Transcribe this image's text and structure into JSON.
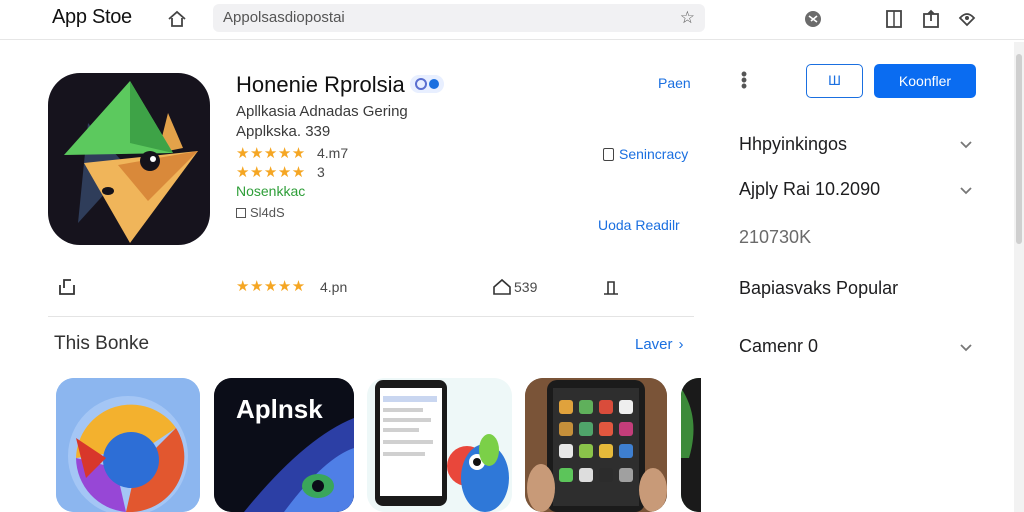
{
  "topbar": {
    "logo": "App Stoe",
    "search_value": "Appolsasdiopostai",
    "icons": [
      "home-icon",
      "star-icon",
      "globe-icon",
      "book-icon",
      "share-icon",
      "bell-icon"
    ]
  },
  "app": {
    "name": "Honenie Rprolsia",
    "developer_line": "Apllkasia Adnadas Gering",
    "category_line": "Applkska.  339",
    "rating1_stars": "★★★★★",
    "rating1_value": "4.m7",
    "rating2_stars": "★★★★★",
    "rating2_value": "3",
    "status": "Nosenkkac",
    "size_label": "Sl4dS",
    "icon_name": "app-fox-icon"
  },
  "links": {
    "open": "Paen",
    "summary": "Senincracy",
    "details": "Uoda Readilr"
  },
  "actions": {
    "outline_button": "Ш",
    "primary_button": "Koonfler"
  },
  "stats": {
    "stars": "★★★★★",
    "rating": "4.pn",
    "downloads": "539"
  },
  "panel": {
    "rows": [
      {
        "label": "Hhpyinkingos",
        "chevron": true
      },
      {
        "label": "Ajply  Rai  10.2090",
        "chevron": true
      },
      {
        "label": "210730K",
        "chevron": false
      },
      {
        "label": "Bapiasvaks Popular",
        "chevron": false
      },
      {
        "label": "Camenr 0",
        "chevron": true
      }
    ]
  },
  "section": {
    "title": "This Bonke",
    "more_link": "Laver",
    "cards": [
      {
        "label": "",
        "icon": "swirl-app-icon"
      },
      {
        "label": "Aplnsk",
        "icon": "space-app-icon"
      },
      {
        "label": "",
        "icon": "phone-screenshot"
      },
      {
        "label": "",
        "icon": "tablet-screenshot"
      },
      {
        "label": "",
        "icon": "partial-card"
      }
    ]
  },
  "colors": {
    "accent": "#0a6cf1",
    "star": "#f5a623",
    "green": "#2e9e38"
  }
}
